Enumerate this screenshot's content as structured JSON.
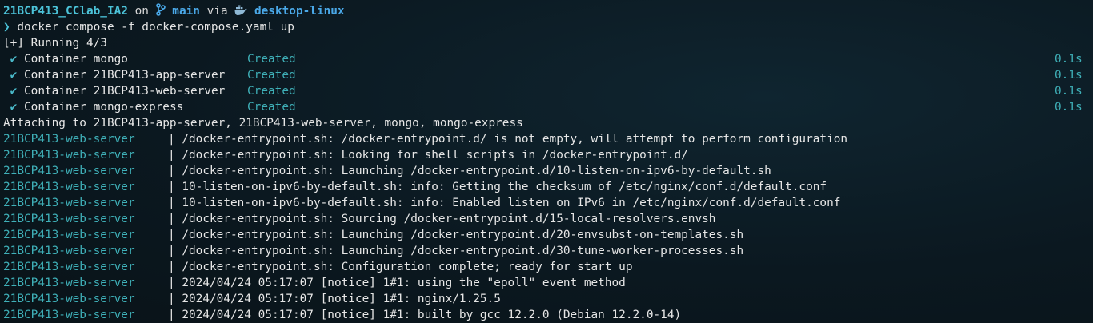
{
  "prompt": {
    "directory": "21BCP413_CClab_IA2",
    "on_word": "on",
    "branch": "main",
    "via_word": "via",
    "docker_context": "desktop-linux",
    "symbol": "❯",
    "command": "docker compose -f docker-compose.yaml up"
  },
  "running_status": "[+] Running 4/3",
  "containers": [
    {
      "check": "✔",
      "label": "Container mongo",
      "status": "Created",
      "time": "0.1s"
    },
    {
      "check": "✔",
      "label": "Container 21BCP413-app-server",
      "status": "Created",
      "time": "0.1s"
    },
    {
      "check": "✔",
      "label": "Container 21BCP413-web-server",
      "status": "Created",
      "time": "0.1s"
    },
    {
      "check": "✔",
      "label": "Container mongo-express",
      "status": "Created",
      "time": "0.1s"
    }
  ],
  "attaching": "Attaching to 21BCP413-app-server, 21BCP413-web-server, mongo, mongo-express",
  "log_separator": "|",
  "logs": [
    {
      "service": "21BCP413-web-server",
      "message": "/docker-entrypoint.sh: /docker-entrypoint.d/ is not empty, will attempt to perform configuration"
    },
    {
      "service": "21BCP413-web-server",
      "message": "/docker-entrypoint.sh: Looking for shell scripts in /docker-entrypoint.d/"
    },
    {
      "service": "21BCP413-web-server",
      "message": "/docker-entrypoint.sh: Launching /docker-entrypoint.d/10-listen-on-ipv6-by-default.sh"
    },
    {
      "service": "21BCP413-web-server",
      "message": "10-listen-on-ipv6-by-default.sh: info: Getting the checksum of /etc/nginx/conf.d/default.conf"
    },
    {
      "service": "21BCP413-web-server",
      "message": "10-listen-on-ipv6-by-default.sh: info: Enabled listen on IPv6 in /etc/nginx/conf.d/default.conf"
    },
    {
      "service": "21BCP413-web-server",
      "message": "/docker-entrypoint.sh: Sourcing /docker-entrypoint.d/15-local-resolvers.envsh"
    },
    {
      "service": "21BCP413-web-server",
      "message": "/docker-entrypoint.sh: Launching /docker-entrypoint.d/20-envsubst-on-templates.sh"
    },
    {
      "service": "21BCP413-web-server",
      "message": "/docker-entrypoint.sh: Launching /docker-entrypoint.d/30-tune-worker-processes.sh"
    },
    {
      "service": "21BCP413-web-server",
      "message": "/docker-entrypoint.sh: Configuration complete; ready for start up"
    },
    {
      "service": "21BCP413-web-server",
      "message": "2024/04/24 05:17:07 [notice] 1#1: using the \"epoll\" event method"
    },
    {
      "service": "21BCP413-web-server",
      "message": "2024/04/24 05:17:07 [notice] 1#1: nginx/1.25.5"
    },
    {
      "service": "21BCP413-web-server",
      "message": "2024/04/24 05:17:07 [notice] 1#1: built by gcc 12.2.0 (Debian 12.2.0-14)"
    }
  ],
  "icons": {
    "branch": "git-branch-icon",
    "docker": "docker-whale-icon"
  },
  "colors": {
    "background": "#0b1820",
    "accent_cyan": "#4cc3d9",
    "branch_blue": "#4aa8e8",
    "service_teal": "#3fb0b8",
    "text": "#e6e6e6"
  }
}
